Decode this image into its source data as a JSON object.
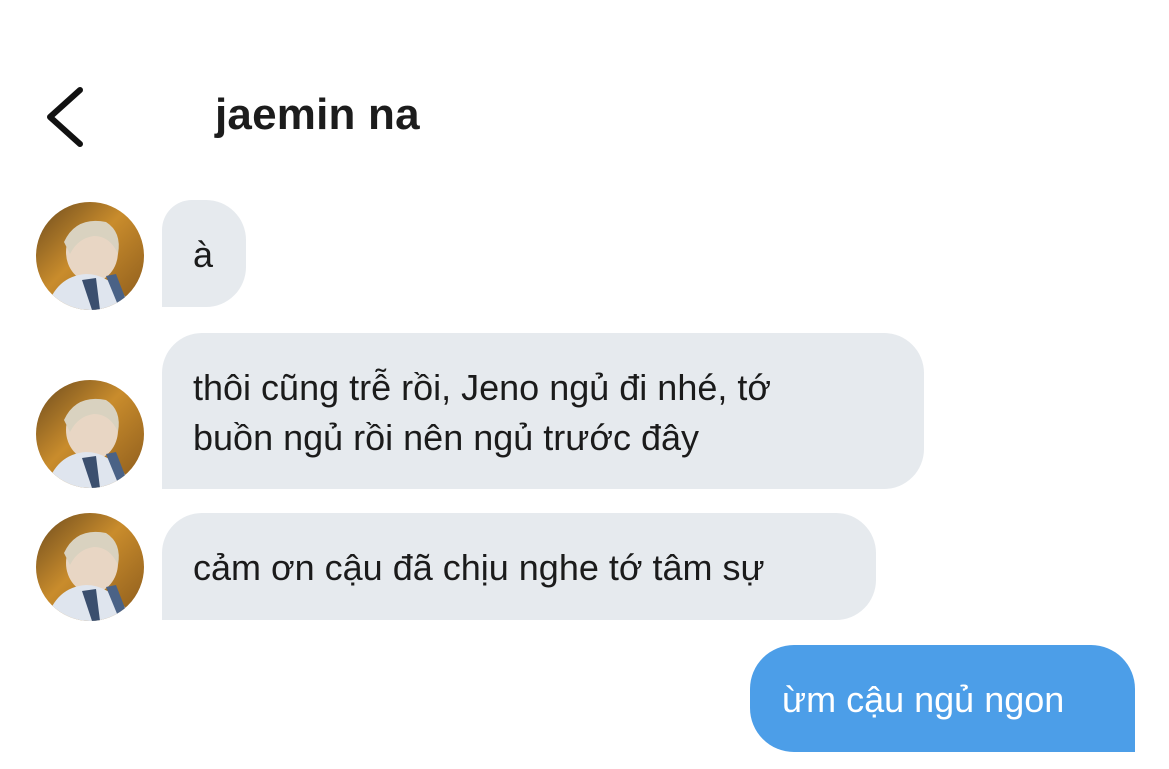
{
  "header": {
    "back_icon": "chevron-left-icon",
    "title": "jaemin na"
  },
  "messages": [
    {
      "sender": "jaemin na",
      "text": "à",
      "show_avatar": true
    },
    {
      "sender": "jaemin na",
      "text": "thôi cũng trễ rồi, Jeno ngủ đi nhé, tớ\nbuồn ngủ rồi nên ngủ trước đây",
      "show_avatar": true
    },
    {
      "sender": "jaemin na",
      "text": "cảm ơn cậu đã chịu nghe tớ tâm sự",
      "show_avatar": true
    },
    {
      "sender": "me",
      "text": "ừm cậu ngủ ngon",
      "show_avatar": false
    }
  ],
  "colors": {
    "incoming_bubble": "#e6eaee",
    "outgoing_bubble": "#4c9ee8",
    "outgoing_text": "#ffffff",
    "title_text": "#1c1c1c"
  }
}
